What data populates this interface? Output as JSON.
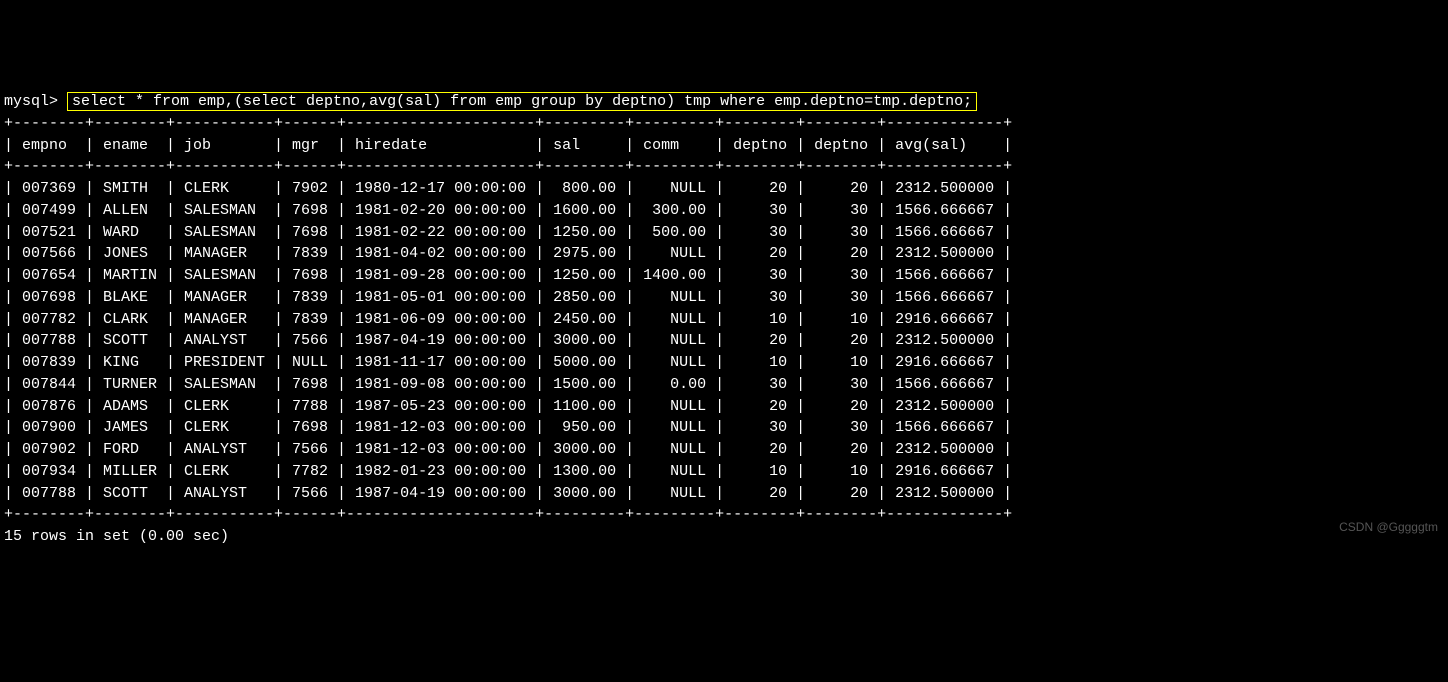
{
  "prompt": "mysql> ",
  "query": "select * from emp,(select deptno,avg(sal) from emp group by deptno) tmp where emp.deptno=tmp.deptno;",
  "border_top": "+--------+--------+-----------+------+---------------------+---------+---------+--------+--------+-------------+",
  "header_line": "| empno  | ename  | job       | mgr  | hiredate            | sal     | comm    | deptno | deptno | avg(sal)    |",
  "border_mid": "+--------+--------+-----------+------+---------------------+---------+---------+--------+--------+-------------+",
  "columns": [
    "empno",
    "ename",
    "job",
    "mgr",
    "hiredate",
    "sal",
    "comm",
    "deptno",
    "deptno",
    "avg(sal)"
  ],
  "rows": [
    {
      "empno": "007369",
      "ename": "SMITH",
      "job": "CLERK",
      "mgr": "7902",
      "hiredate": "1980-12-17 00:00:00",
      "sal": "800.00",
      "comm": "NULL",
      "deptno1": "20",
      "deptno2": "20",
      "avgsal": "2312.500000"
    },
    {
      "empno": "007499",
      "ename": "ALLEN",
      "job": "SALESMAN",
      "mgr": "7698",
      "hiredate": "1981-02-20 00:00:00",
      "sal": "1600.00",
      "comm": "300.00",
      "deptno1": "30",
      "deptno2": "30",
      "avgsal": "1566.666667"
    },
    {
      "empno": "007521",
      "ename": "WARD",
      "job": "SALESMAN",
      "mgr": "7698",
      "hiredate": "1981-02-22 00:00:00",
      "sal": "1250.00",
      "comm": "500.00",
      "deptno1": "30",
      "deptno2": "30",
      "avgsal": "1566.666667"
    },
    {
      "empno": "007566",
      "ename": "JONES",
      "job": "MANAGER",
      "mgr": "7839",
      "hiredate": "1981-04-02 00:00:00",
      "sal": "2975.00",
      "comm": "NULL",
      "deptno1": "20",
      "deptno2": "20",
      "avgsal": "2312.500000"
    },
    {
      "empno": "007654",
      "ename": "MARTIN",
      "job": "SALESMAN",
      "mgr": "7698",
      "hiredate": "1981-09-28 00:00:00",
      "sal": "1250.00",
      "comm": "1400.00",
      "deptno1": "30",
      "deptno2": "30",
      "avgsal": "1566.666667"
    },
    {
      "empno": "007698",
      "ename": "BLAKE",
      "job": "MANAGER",
      "mgr": "7839",
      "hiredate": "1981-05-01 00:00:00",
      "sal": "2850.00",
      "comm": "NULL",
      "deptno1": "30",
      "deptno2": "30",
      "avgsal": "1566.666667"
    },
    {
      "empno": "007782",
      "ename": "CLARK",
      "job": "MANAGER",
      "mgr": "7839",
      "hiredate": "1981-06-09 00:00:00",
      "sal": "2450.00",
      "comm": "NULL",
      "deptno1": "10",
      "deptno2": "10",
      "avgsal": "2916.666667"
    },
    {
      "empno": "007788",
      "ename": "SCOTT",
      "job": "ANALYST",
      "mgr": "7566",
      "hiredate": "1987-04-19 00:00:00",
      "sal": "3000.00",
      "comm": "NULL",
      "deptno1": "20",
      "deptno2": "20",
      "avgsal": "2312.500000"
    },
    {
      "empno": "007839",
      "ename": "KING",
      "job": "PRESIDENT",
      "mgr": "NULL",
      "hiredate": "1981-11-17 00:00:00",
      "sal": "5000.00",
      "comm": "NULL",
      "deptno1": "10",
      "deptno2": "10",
      "avgsal": "2916.666667"
    },
    {
      "empno": "007844",
      "ename": "TURNER",
      "job": "SALESMAN",
      "mgr": "7698",
      "hiredate": "1981-09-08 00:00:00",
      "sal": "1500.00",
      "comm": "0.00",
      "deptno1": "30",
      "deptno2": "30",
      "avgsal": "1566.666667"
    },
    {
      "empno": "007876",
      "ename": "ADAMS",
      "job": "CLERK",
      "mgr": "7788",
      "hiredate": "1987-05-23 00:00:00",
      "sal": "1100.00",
      "comm": "NULL",
      "deptno1": "20",
      "deptno2": "20",
      "avgsal": "2312.500000"
    },
    {
      "empno": "007900",
      "ename": "JAMES",
      "job": "CLERK",
      "mgr": "7698",
      "hiredate": "1981-12-03 00:00:00",
      "sal": "950.00",
      "comm": "NULL",
      "deptno1": "30",
      "deptno2": "30",
      "avgsal": "1566.666667"
    },
    {
      "empno": "007902",
      "ename": "FORD",
      "job": "ANALYST",
      "mgr": "7566",
      "hiredate": "1981-12-03 00:00:00",
      "sal": "3000.00",
      "comm": "NULL",
      "deptno1": "20",
      "deptno2": "20",
      "avgsal": "2312.500000"
    },
    {
      "empno": "007934",
      "ename": "MILLER",
      "job": "CLERK",
      "mgr": "7782",
      "hiredate": "1982-01-23 00:00:00",
      "sal": "1300.00",
      "comm": "NULL",
      "deptno1": "10",
      "deptno2": "10",
      "avgsal": "2916.666667"
    },
    {
      "empno": "007788",
      "ename": "SCOTT",
      "job": "ANALYST",
      "mgr": "7566",
      "hiredate": "1987-04-19 00:00:00",
      "sal": "3000.00",
      "comm": "NULL",
      "deptno1": "20",
      "deptno2": "20",
      "avgsal": "2312.500000"
    }
  ],
  "border_bot": "+--------+--------+-----------+------+---------------------+---------+---------+--------+--------+-------------+",
  "footer": "15 rows in set (0.00 sec)",
  "watermark": "CSDN @Gggggtm"
}
